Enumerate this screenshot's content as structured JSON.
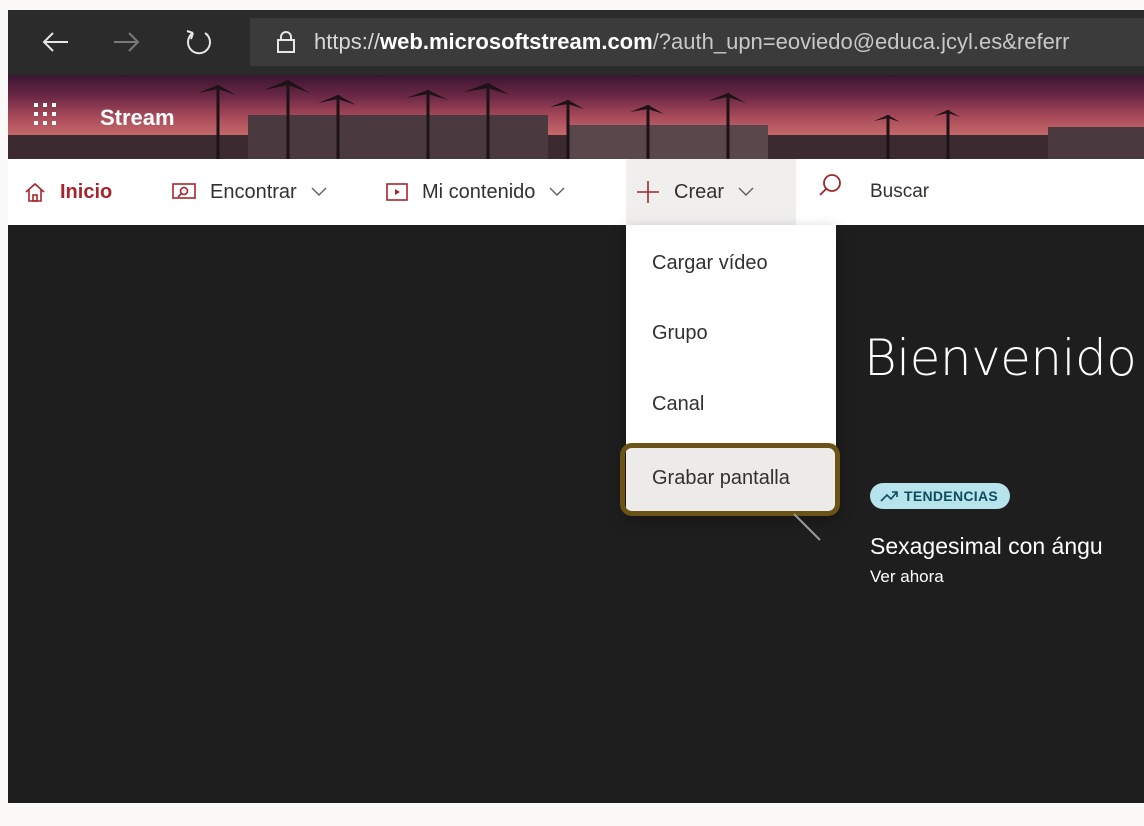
{
  "browser": {
    "url_protocol": "https://",
    "url_host": "web.microsoftstream.com",
    "url_rest": "/?auth_upn=eoviedo@educa.jcyl.es&referr"
  },
  "app": {
    "brand": "Stream"
  },
  "nav": {
    "inicio": "Inicio",
    "encontrar": "Encontrar",
    "mi_contenido": "Mi contenido",
    "crear": "Crear",
    "buscar": "Buscar"
  },
  "menu": {
    "items": [
      "Cargar vídeo",
      "Grupo",
      "Canal",
      "Grabar pantalla"
    ]
  },
  "hero": {
    "welcome": "Bienvenido",
    "badge": "TENDENCIAS",
    "video_title": "Sexagesimal con ángu",
    "watch": "Ver ahora"
  },
  "colors": {
    "accent": "#a4262c",
    "highlight_border": "#6b5318",
    "badge_bg": "#b6e3ec"
  }
}
